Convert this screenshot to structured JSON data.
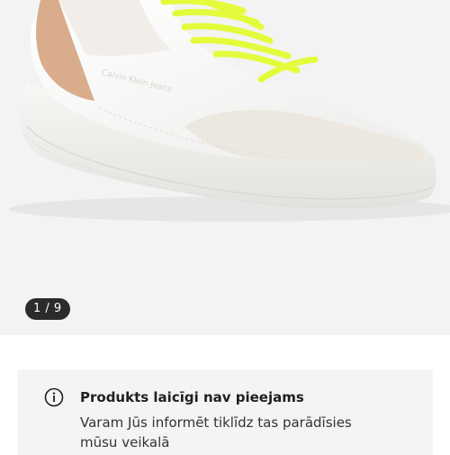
{
  "gallery": {
    "product_image": "sneaker-photo",
    "brand_print": "Calvin Klein Jeans",
    "counter": "1 / 9"
  },
  "availability": {
    "icon": "info-icon",
    "title": "Produkts laicīgi nav pieejams",
    "message": "Varam Jūs informēt tiklīdz tas parādīsies mūsu veikalā"
  },
  "colors": {
    "lace": "#e4fb3c",
    "heel_tab": "#d9ad8c",
    "suede": "#ece7df",
    "gallery_bg": "#f3f3f3",
    "notice_bg": "#f4f4f4"
  }
}
